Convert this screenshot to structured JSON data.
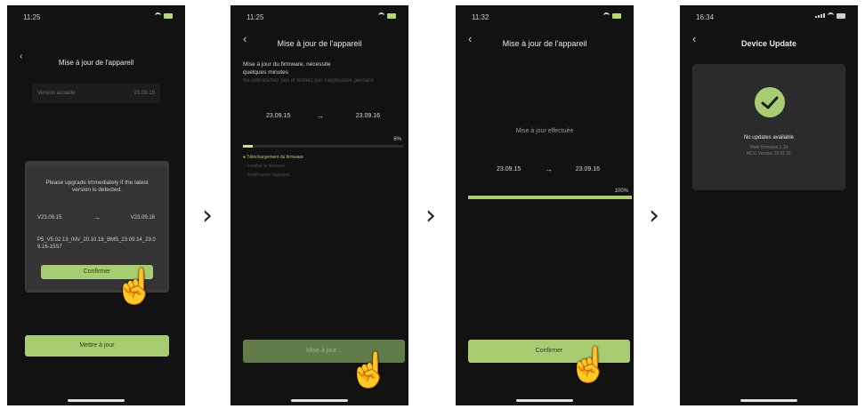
{
  "screen1": {
    "time": "11:25",
    "title": "Mise à jour de l'appareil",
    "version_label": "Version actuelle",
    "version_value": "23.09.15",
    "dialog": {
      "text": "Please upgrade immediately if the latest version is detected.",
      "from_version": "V23.09.15",
      "arrow": "→",
      "to_version": "V23.09.16",
      "package": "P5_V5.02.13_INV_20.10.16_BMS_23.09.14_23.09.16-15S7",
      "confirm_label": "Confirmer"
    },
    "update_button": "Mettre à jour"
  },
  "screen2": {
    "time": "11:25",
    "title": "Mise à jour de l'appareil",
    "desc_line1": "Mise à jour du firmware, nécessite",
    "desc_line2": "quelques minutes",
    "desc_line3": "Ne débranchez pas et fermez pas l'application pendant",
    "from_version": "23.09.15",
    "arrow": "→",
    "to_version": "23.09.16",
    "percent": "6%",
    "progress": 0.06,
    "steps": [
      "Téléchargement du firmware",
      "Installer le firmware",
      "Redémarrer l'appareil"
    ],
    "button_label": "Mise à jour..."
  },
  "screen3": {
    "time": "11:32",
    "title": "Mise à jour de l'appareil",
    "status_text": "Mise à jour effectuée",
    "from_version": "23.09.15",
    "arrow": "→",
    "to_version": "23.09.16",
    "percent": "100%",
    "progress": 1.0,
    "confirm_label": "Confirmer"
  },
  "screen4": {
    "time": "16:34",
    "title": "Device Update",
    "status": "No updates available",
    "line1": "Main firmware 1.14",
    "line2": "MCU Version 20.01.01"
  },
  "separator": "›",
  "colors": {
    "accent": "#a7cc72",
    "phone_bg": "#111211"
  }
}
